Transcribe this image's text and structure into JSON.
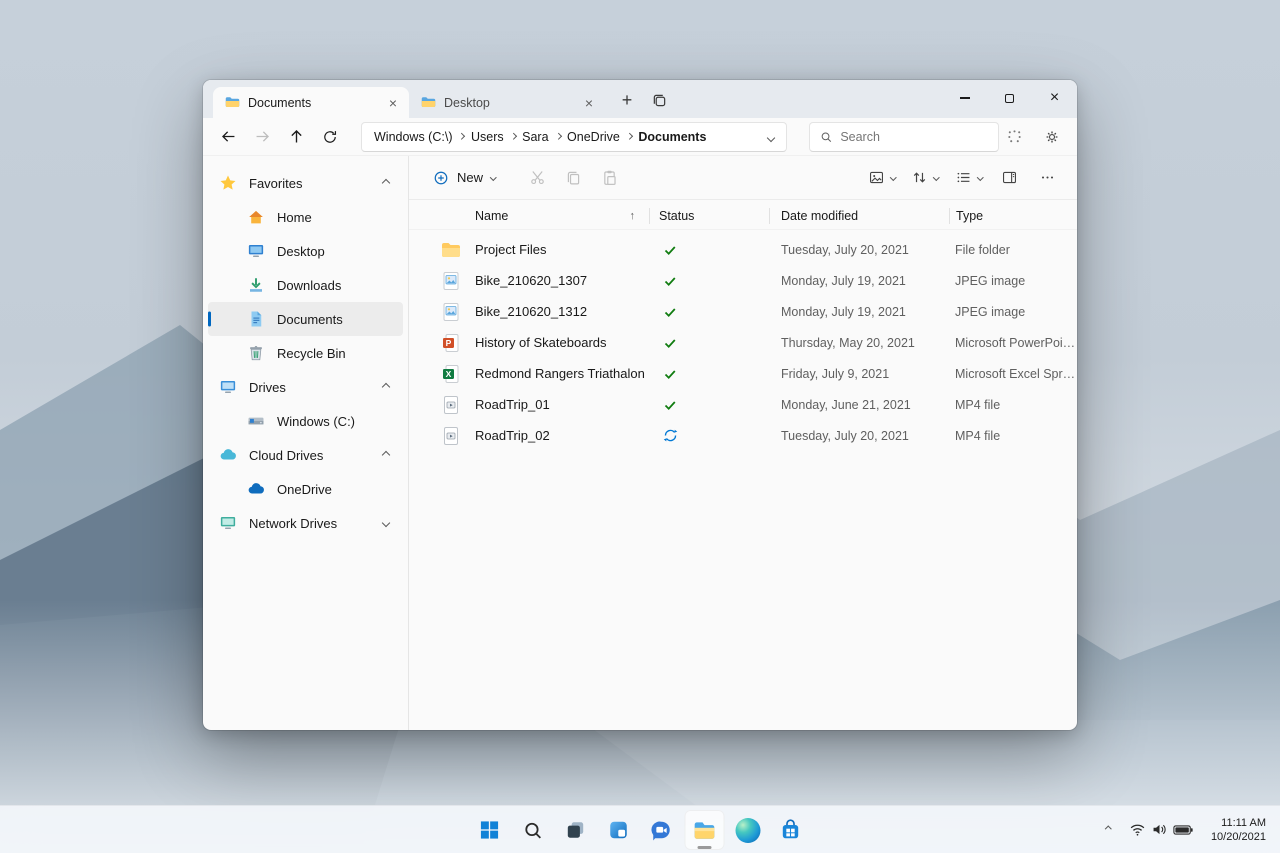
{
  "colors": {
    "accent": "#0067c0",
    "synced_green": "#107c10",
    "syncing_blue": "#0078d4"
  },
  "window": {
    "tabs": [
      {
        "label": "Documents",
        "icon": "folder-icon",
        "active": true
      },
      {
        "label": "Desktop",
        "icon": "folder-icon",
        "active": false
      }
    ],
    "breadcrumb": {
      "segments": [
        "Windows (C:\\)",
        "Users",
        "Sara",
        "OneDrive",
        "Documents"
      ]
    },
    "search": {
      "placeholder": "Search"
    },
    "toolbar": {
      "new_label": "New"
    },
    "columns": {
      "name": "Name",
      "status": "Status",
      "date_modified": "Date modified",
      "type": "Type"
    },
    "sidebar": {
      "favorites": {
        "label": "Favorites",
        "items": [
          {
            "label": "Home",
            "icon": "home-icon"
          },
          {
            "label": "Desktop",
            "icon": "monitor-icon"
          },
          {
            "label": "Downloads",
            "icon": "downloads-icon"
          },
          {
            "label": "Documents",
            "icon": "document-icon",
            "selected": true
          },
          {
            "label": "Recycle Bin",
            "icon": "recycle-bin-icon"
          }
        ]
      },
      "drives": {
        "label": "Drives",
        "items": [
          {
            "label": "Windows (C:)",
            "icon": "hard-drive-icon"
          }
        ]
      },
      "cloud": {
        "label": "Cloud Drives",
        "items": [
          {
            "label": "OneDrive",
            "icon": "onedrive-cloud-icon"
          }
        ]
      },
      "network": {
        "label": "Network Drives",
        "items": []
      }
    },
    "files": [
      {
        "name": "Project Files",
        "icon": "folder",
        "status": "synced",
        "date_modified": "Tuesday, July 20, 2021",
        "type": "File folder"
      },
      {
        "name": "Bike_210620_1307",
        "icon": "jpeg",
        "status": "synced",
        "date_modified": "Monday, July 19, 2021",
        "type": "JPEG image"
      },
      {
        "name": "Bike_210620_1312",
        "icon": "jpeg",
        "status": "synced",
        "date_modified": "Monday, July 19, 2021",
        "type": "JPEG image"
      },
      {
        "name": "History of Skateboards",
        "icon": "powerpoint",
        "status": "synced",
        "date_modified": "Thursday, May 20, 2021",
        "type": "Microsoft PowerPoi…"
      },
      {
        "name": "Redmond Rangers Triathalon",
        "icon": "excel",
        "status": "synced",
        "date_modified": "Friday, July 9, 2021",
        "type": "Microsoft Excel Spr…"
      },
      {
        "name": "RoadTrip_01",
        "icon": "mp4",
        "status": "synced",
        "date_modified": "Monday, June 21, 2021",
        "type": "MP4 file"
      },
      {
        "name": "RoadTrip_02",
        "icon": "mp4",
        "status": "syncing",
        "date_modified": "Tuesday, July 20, 2021",
        "type": "MP4 file"
      }
    ]
  },
  "taskbar": {
    "time": "11:11 AM",
    "date": "10/20/2021"
  }
}
